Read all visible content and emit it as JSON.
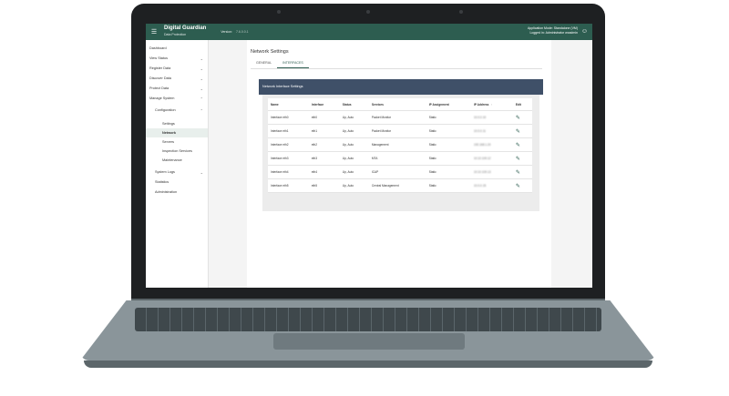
{
  "header": {
    "brand_name": "Digital Guardian",
    "brand_sub": "Data Protection",
    "version_label": "Version:",
    "version_value": "7.6.0.0.1",
    "app_mode": "Application Mode: Standalone (VM)",
    "logged_in": "Logged in: Administrator   wxadmin",
    "menu_icon": "hamburger-icon",
    "user_icon": "user-icon"
  },
  "sidebar": {
    "items": [
      {
        "label": "Dashboard",
        "chev": ""
      },
      {
        "label": "View Status",
        "chev": "⌄"
      },
      {
        "label": "Register Data",
        "chev": "⌄"
      },
      {
        "label": "Discover Data",
        "chev": "⌄"
      },
      {
        "label": "Protect Data",
        "chev": "⌄"
      },
      {
        "label": "Manage System",
        "chev": "⌃"
      },
      {
        "label": "Configuration",
        "chev": "⌃"
      },
      {
        "label": "Settings",
        "chev": ""
      },
      {
        "label": "Network",
        "chev": ""
      },
      {
        "label": "Servers",
        "chev": ""
      },
      {
        "label": "Inspection Services",
        "chev": ""
      },
      {
        "label": "Maintenance",
        "chev": ""
      },
      {
        "label": "System Logs",
        "chev": "⌄"
      },
      {
        "label": "Statistics",
        "chev": ""
      },
      {
        "label": "Administration",
        "chev": ""
      }
    ]
  },
  "page": {
    "title": "Network Settings",
    "tabs": [
      "GENERAL",
      "INTERFACES"
    ],
    "panel_title": "Network Interface Settings"
  },
  "table": {
    "headers": [
      "Name",
      "Interface",
      "Status",
      "Services",
      "IP Assignment",
      "IP Address",
      "Edit"
    ],
    "rows": [
      [
        "Interface eth0",
        "eth0",
        "Up, Auto",
        "Packet Monitor",
        "Static",
        "10.0.0.10"
      ],
      [
        "Interface eth1",
        "eth1",
        "Up, Auto",
        "Packet Monitor",
        "Static",
        "10.0.0.11"
      ],
      [
        "Interface eth2",
        "eth2",
        "Up, Auto",
        "Management",
        "Static",
        "192.168.1.20"
      ],
      [
        "Interface eth3",
        "eth3",
        "Up, Auto",
        "MTA",
        "Static",
        "10.10.100.12"
      ],
      [
        "Interface eth4",
        "eth4",
        "Up, Auto",
        "ICAP",
        "Static",
        "10.10.100.13"
      ],
      [
        "Interface eth5",
        "eth5",
        "Up, Auto",
        "Central Management",
        "Static",
        "10.0.0.15"
      ]
    ]
  },
  "colors": {
    "brand": "#2d5d50",
    "panel_header": "#3f5068"
  }
}
